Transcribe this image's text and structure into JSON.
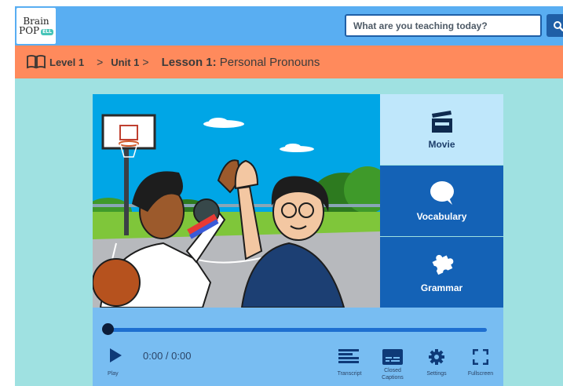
{
  "header": {
    "logo": {
      "line1": "Brain",
      "line2": "POP",
      "badge": "ELL"
    },
    "search": {
      "placeholder": "What are you teaching today?"
    }
  },
  "breadcrumb": {
    "level": "Level 1",
    "unit": "Unit 1",
    "separator": ">",
    "lesson_prefix": "Lesson 1:",
    "lesson_title": "Personal Pronouns"
  },
  "tabs": [
    {
      "label": "Movie",
      "icon": "clapperboard-icon"
    },
    {
      "label": "Vocabulary",
      "icon": "speech-bubble-icon"
    },
    {
      "label": "Grammar",
      "icon": "puzzle-icon"
    }
  ],
  "player": {
    "time": "0:00 / 0:00",
    "progress": 0,
    "play_label": "Play",
    "transcript_label": "Transcript",
    "captions_label_1": "Closed",
    "captions_label_2": "Captions",
    "settings_label": "Settings",
    "fullscreen_label": "Fullscreen"
  },
  "colors": {
    "header": "#59aef2",
    "breadcrumb_bar": "#ff8a5c",
    "background": "#9fe1e1",
    "tab_active": "#bfe7fb",
    "tab_inactive": "#1462b6",
    "controls": "#78bdf2"
  }
}
